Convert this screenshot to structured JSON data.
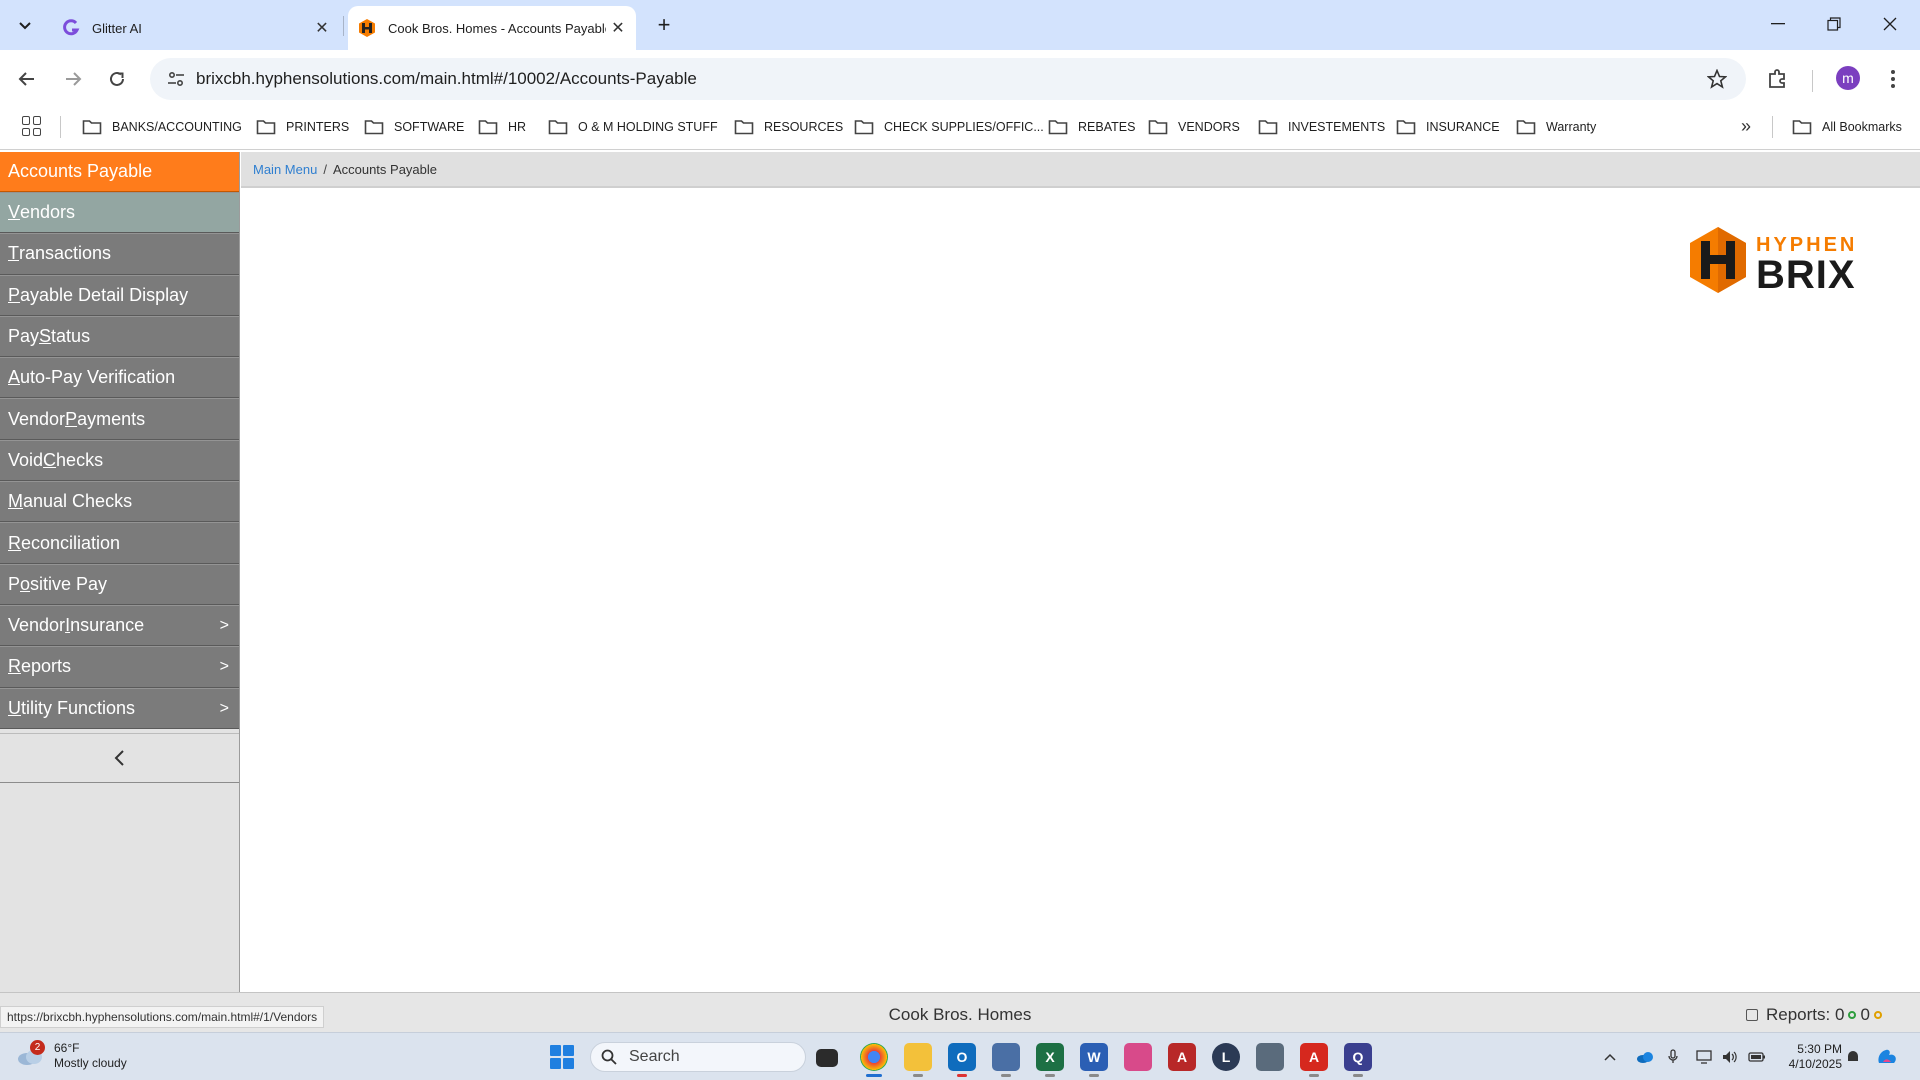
{
  "browser": {
    "tabs": [
      {
        "title": "Glitter AI",
        "active": false
      },
      {
        "title": "Cook Bros. Homes - Accounts Payable",
        "active": true
      }
    ],
    "url": "brixcbh.hyphensolutions.com/main.html#/10002/Accounts-Payable",
    "profile_initial": "m",
    "bookmarks": [
      "BANKS/ACCOUNTING",
      "PRINTERS",
      "SOFTWARE",
      "HR",
      "O & M HOLDING STUFF",
      "RESOURCES",
      "CHECK SUPPLIES/OFFIC...",
      "REBATES",
      "VENDORS",
      "INVESTEMENTS",
      "INSURANCE",
      "Warranty"
    ],
    "all_bookmarks": "All Bookmarks",
    "more": "»"
  },
  "sidebar": {
    "header": "Accounts Payable",
    "items": [
      {
        "pre": "",
        "ul": "V",
        "post": "endors",
        "submenu": false
      },
      {
        "pre": "",
        "ul": "T",
        "post": "ransactions",
        "submenu": false
      },
      {
        "pre": "",
        "ul": "P",
        "post": "ayable Detail Display",
        "submenu": false
      },
      {
        "pre": "Pay ",
        "ul": "S",
        "post": "tatus",
        "submenu": false
      },
      {
        "pre": "",
        "ul": "A",
        "post": "uto-Pay Verification",
        "submenu": false
      },
      {
        "pre": "Vendor ",
        "ul": "P",
        "post": "ayments",
        "submenu": false
      },
      {
        "pre": "Void ",
        "ul": "C",
        "post": "hecks",
        "submenu": false
      },
      {
        "pre": "",
        "ul": "M",
        "post": "anual Checks",
        "submenu": false
      },
      {
        "pre": "",
        "ul": "R",
        "post": "econciliation",
        "submenu": false
      },
      {
        "pre": "P",
        "ul": "o",
        "post": "sitive Pay",
        "submenu": false
      },
      {
        "pre": "Vendor ",
        "ul": "I",
        "post": "nsurance",
        "submenu": true
      },
      {
        "pre": "",
        "ul": "R",
        "post": "eports",
        "submenu": true
      },
      {
        "pre": "",
        "ul": "U",
        "post": "tility Functions",
        "submenu": true
      }
    ],
    "submenu_arrow": ">"
  },
  "breadcrumb": {
    "link": "Main Menu",
    "separator": "/",
    "current": "Accounts Payable"
  },
  "logo": {
    "line1": "HYPHEN",
    "line2": "BRIX"
  },
  "statusbar": {
    "hover_url": "https://brixcbh.hyphensolutions.com/main.html#/1/Vendors",
    "company": "Cook Bros. Homes",
    "reports_label": "Reports: 0",
    "reports_count2": "0"
  },
  "taskbar": {
    "weather_temp": "66°F",
    "weather_desc": "Mostly cloudy",
    "weather_badge": "2",
    "search_placeholder": "Search",
    "time": "5:30 PM",
    "date": "4/10/2025"
  },
  "colors": {
    "accent": "#ff7c1b",
    "menu_item": "#7b7b7b",
    "menu_selected": "#93a6a2",
    "link": "#2f7fd0"
  }
}
